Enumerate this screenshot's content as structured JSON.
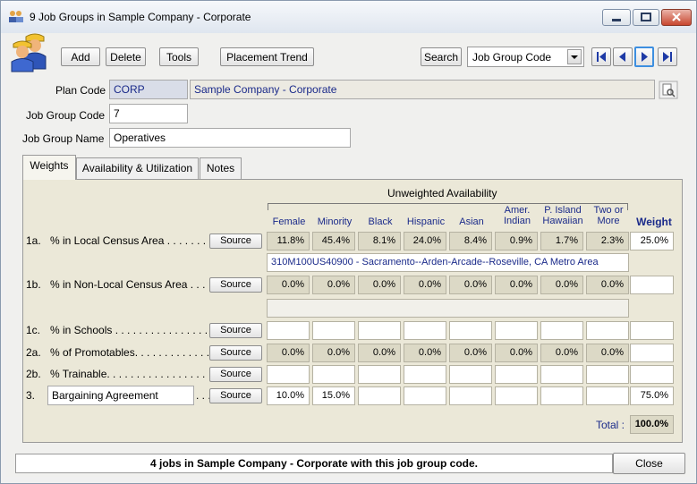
{
  "window": {
    "title": "9 Job Groups in Sample Company - Corporate"
  },
  "toolbar": {
    "add": "Add",
    "delete": "Delete",
    "tools": "Tools",
    "placement": "Placement Trend",
    "search": "Search",
    "search_select": "Job Group Code"
  },
  "form": {
    "plan_code_label": "Plan Code",
    "plan_code": "CORP",
    "plan_name": "Sample Company - Corporate",
    "job_group_code_label": "Job Group Code",
    "job_group_code": "7",
    "job_group_name_label": "Job Group Name",
    "job_group_name": "Operatives"
  },
  "tabs": [
    "Weights",
    "Availability & Utilization",
    "Notes"
  ],
  "grid": {
    "group_header": "Unweighted Availability",
    "columns": [
      "Female",
      "Minority",
      "Black",
      "Hispanic",
      "Asian",
      "Amer.\nIndian",
      "P. Island\nHawaiian",
      "Two or\nMore"
    ],
    "weight_header": "Weight",
    "source_label": "Source",
    "rows": [
      {
        "num": "1a.",
        "label": "% in Local Census Area . . . . . . .",
        "values": [
          "11.8%",
          "45.4%",
          "8.1%",
          "24.0%",
          "8.4%",
          "0.9%",
          "1.7%",
          "2.3%"
        ],
        "weight": "25.0%",
        "geo": "310M100US40900 - Sacramento--Arden-Arcade--Roseville, CA Metro Area"
      },
      {
        "num": "1b.",
        "label": "% in Non-Local Census Area . . .",
        "values": [
          "0.0%",
          "0.0%",
          "0.0%",
          "0.0%",
          "0.0%",
          "0.0%",
          "0.0%",
          "0.0%"
        ],
        "weight": ""
      },
      {
        "num": "1c.",
        "label": "% in Schools . . . . . . . . . . . . . . . .",
        "values": [
          "",
          "",
          "",
          "",
          "",
          "",
          "",
          ""
        ],
        "weight": ""
      },
      {
        "num": "2a.",
        "label": "% of Promotables. . . . . . . . . . . . .",
        "values": [
          "0.0%",
          "0.0%",
          "0.0%",
          "0.0%",
          "0.0%",
          "0.0%",
          "0.0%",
          "0.0%"
        ],
        "weight": ""
      },
      {
        "num": "2b.",
        "label": "% Trainable. . . . . . . . . . . . . . . . .",
        "values": [
          "",
          "",
          "",
          "",
          "",
          "",
          "",
          ""
        ],
        "weight": ""
      },
      {
        "num": "3.",
        "label": "Bargaining Agreement",
        "dots": ". . .",
        "values": [
          "10.0%",
          "15.0%",
          "",
          "",
          "",
          "",
          "",
          ""
        ],
        "weight": "75.0%"
      }
    ],
    "total_label": "Total :",
    "total_value": "100.0%"
  },
  "status": {
    "text": "4 jobs in Sample Company - Corporate with this job group code.",
    "close": "Close"
  }
}
